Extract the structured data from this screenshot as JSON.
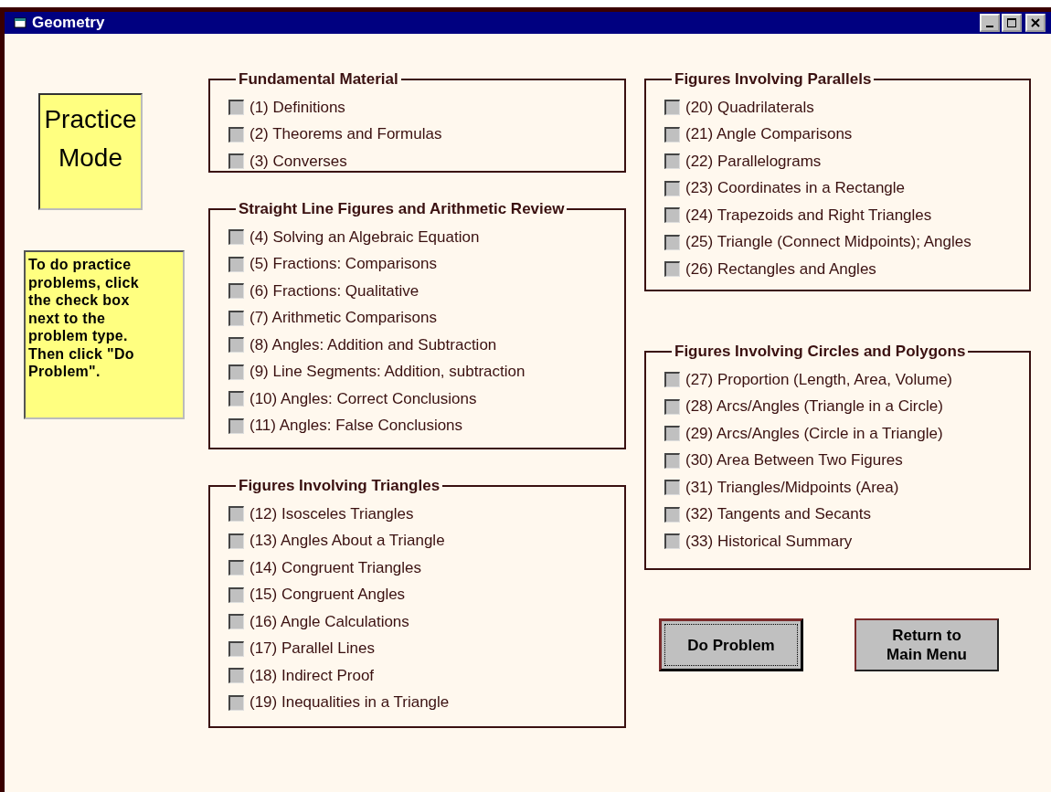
{
  "window": {
    "title": "Geometry"
  },
  "mode_label": "Practice Mode",
  "instructions": "To do practice problems, click the check box next to the problem type. Then click \"Do Problem\".",
  "columns": [
    {
      "groups": [
        {
          "title": "Fundamental Material",
          "items": [
            {
              "label": "(1) Definitions",
              "checked": false
            },
            {
              "label": "(2) Theorems and Formulas",
              "checked": false
            },
            {
              "label": "(3) Converses",
              "checked": false
            }
          ]
        },
        {
          "title": "Straight Line Figures and Arithmetic Review",
          "items": [
            {
              "label": "(4) Solving an Algebraic Equation",
              "checked": false
            },
            {
              "label": "(5) Fractions: Comparisons",
              "checked": false
            },
            {
              "label": "(6) Fractions: Qualitative",
              "checked": false
            },
            {
              "label": "(7) Arithmetic Comparisons",
              "checked": false
            },
            {
              "label": "(8) Angles: Addition and Subtraction",
              "checked": false
            },
            {
              "label": "(9) Line Segments: Addition, subtraction",
              "checked": false
            },
            {
              "label": "(10) Angles: Correct Conclusions",
              "checked": false
            },
            {
              "label": "(11) Angles: False Conclusions",
              "checked": false
            }
          ]
        },
        {
          "title": "Figures Involving Triangles",
          "items": [
            {
              "label": "(12) Isosceles Triangles",
              "checked": false
            },
            {
              "label": "(13) Angles About a Triangle",
              "checked": false
            },
            {
              "label": "(14) Congruent Triangles",
              "checked": false
            },
            {
              "label": "(15) Congruent Angles",
              "checked": false
            },
            {
              "label": "(16) Angle Calculations",
              "checked": false
            },
            {
              "label": "(17) Parallel Lines",
              "checked": false
            },
            {
              "label": "(18) Indirect Proof",
              "checked": false
            },
            {
              "label": "(19) Inequalities in a Triangle",
              "checked": false
            }
          ]
        }
      ]
    },
    {
      "groups": [
        {
          "title": "Figures Involving Parallels",
          "items": [
            {
              "label": "(20) Quadrilaterals",
              "checked": false
            },
            {
              "label": "(21) Angle Comparisons",
              "checked": false
            },
            {
              "label": "(22) Parallelograms",
              "checked": false
            },
            {
              "label": "(23) Coordinates in a Rectangle",
              "checked": false
            },
            {
              "label": "(24) Trapezoids and Right Triangles",
              "checked": false
            },
            {
              "label": "(25) Triangle (Connect Midpoints); Angles",
              "checked": false
            },
            {
              "label": "(26) Rectangles and Angles",
              "checked": false
            }
          ]
        },
        {
          "title": "Figures Involving Circles and Polygons",
          "items": [
            {
              "label": "(27) Proportion (Length, Area, Volume)",
              "checked": false
            },
            {
              "label": "(28) Arcs/Angles (Triangle in a Circle)",
              "checked": false
            },
            {
              "label": "(29) Arcs/Angles (Circle in a Triangle)",
              "checked": false
            },
            {
              "label": "(30) Area Between Two Figures",
              "checked": false
            },
            {
              "label": "(31) Triangles/Midpoints (Area)",
              "checked": false
            },
            {
              "label": "(32) Tangents and Secants",
              "checked": false
            },
            {
              "label": "(33) Historical Summary",
              "checked": false
            }
          ]
        }
      ]
    }
  ],
  "buttons": [
    {
      "label": "Do Problem",
      "focused": true
    },
    {
      "label": "Return to Main Menu",
      "focused": false
    }
  ]
}
